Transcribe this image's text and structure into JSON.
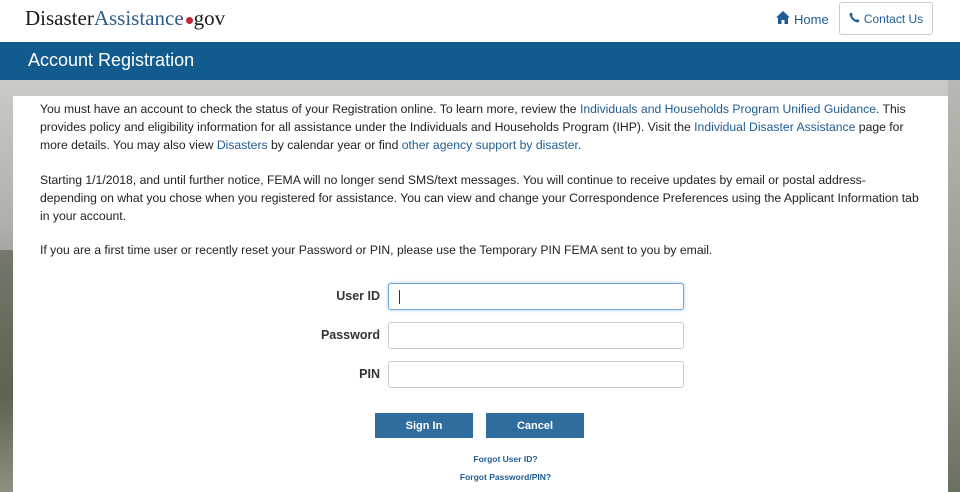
{
  "header": {
    "logo": {
      "part1": "Disaster",
      "part2": "Assistance",
      "part3": "gov"
    },
    "home_label": "Home",
    "contact_label": "Contact Us"
  },
  "page": {
    "title": "Account Registration"
  },
  "intro": {
    "p1_a": "You must have an account to check the status of your Registration online. To learn more, review the ",
    "link_guidance": "Individuals and Households Program Unified Guidance",
    "p1_b": ". This provides policy and eligibility information for all assistance under the Individuals and Households Program (IHP). Visit the ",
    "link_ida": "Individual Disaster Assistance",
    "p1_c": " page for more details. You may also view ",
    "link_disasters": "Disasters",
    "p1_d": " by calendar year or find ",
    "link_agency": "other agency support by disaster",
    "p1_e": ".",
    "p2": "Starting 1/1/2018, and until further notice, FEMA will no longer send SMS/text messages. You will continue to receive updates by email or postal address- depending on what you chose when you registered for assistance. You can view and change your Correspondence Preferences using the Applicant Information tab in your account.",
    "p3": "If you are a first time user or recently reset your Password or PIN, please use the Temporary PIN FEMA sent to you by email."
  },
  "form": {
    "userid_label": "User ID",
    "userid_value": "",
    "password_label": "Password",
    "password_value": "",
    "pin_label": "PIN",
    "pin_value": "",
    "signin_label": "Sign In",
    "cancel_label": "Cancel",
    "forgot_userid": "Forgot User ID?",
    "forgot_password": "Forgot Password/PIN?"
  },
  "colors": {
    "brand_blue": "#125b8e",
    "link_blue": "#1f5c94",
    "logo_dot": "#c2252d",
    "button_blue": "#2f6d9e"
  },
  "icons": {
    "home": "home-icon",
    "phone": "phone-icon"
  }
}
